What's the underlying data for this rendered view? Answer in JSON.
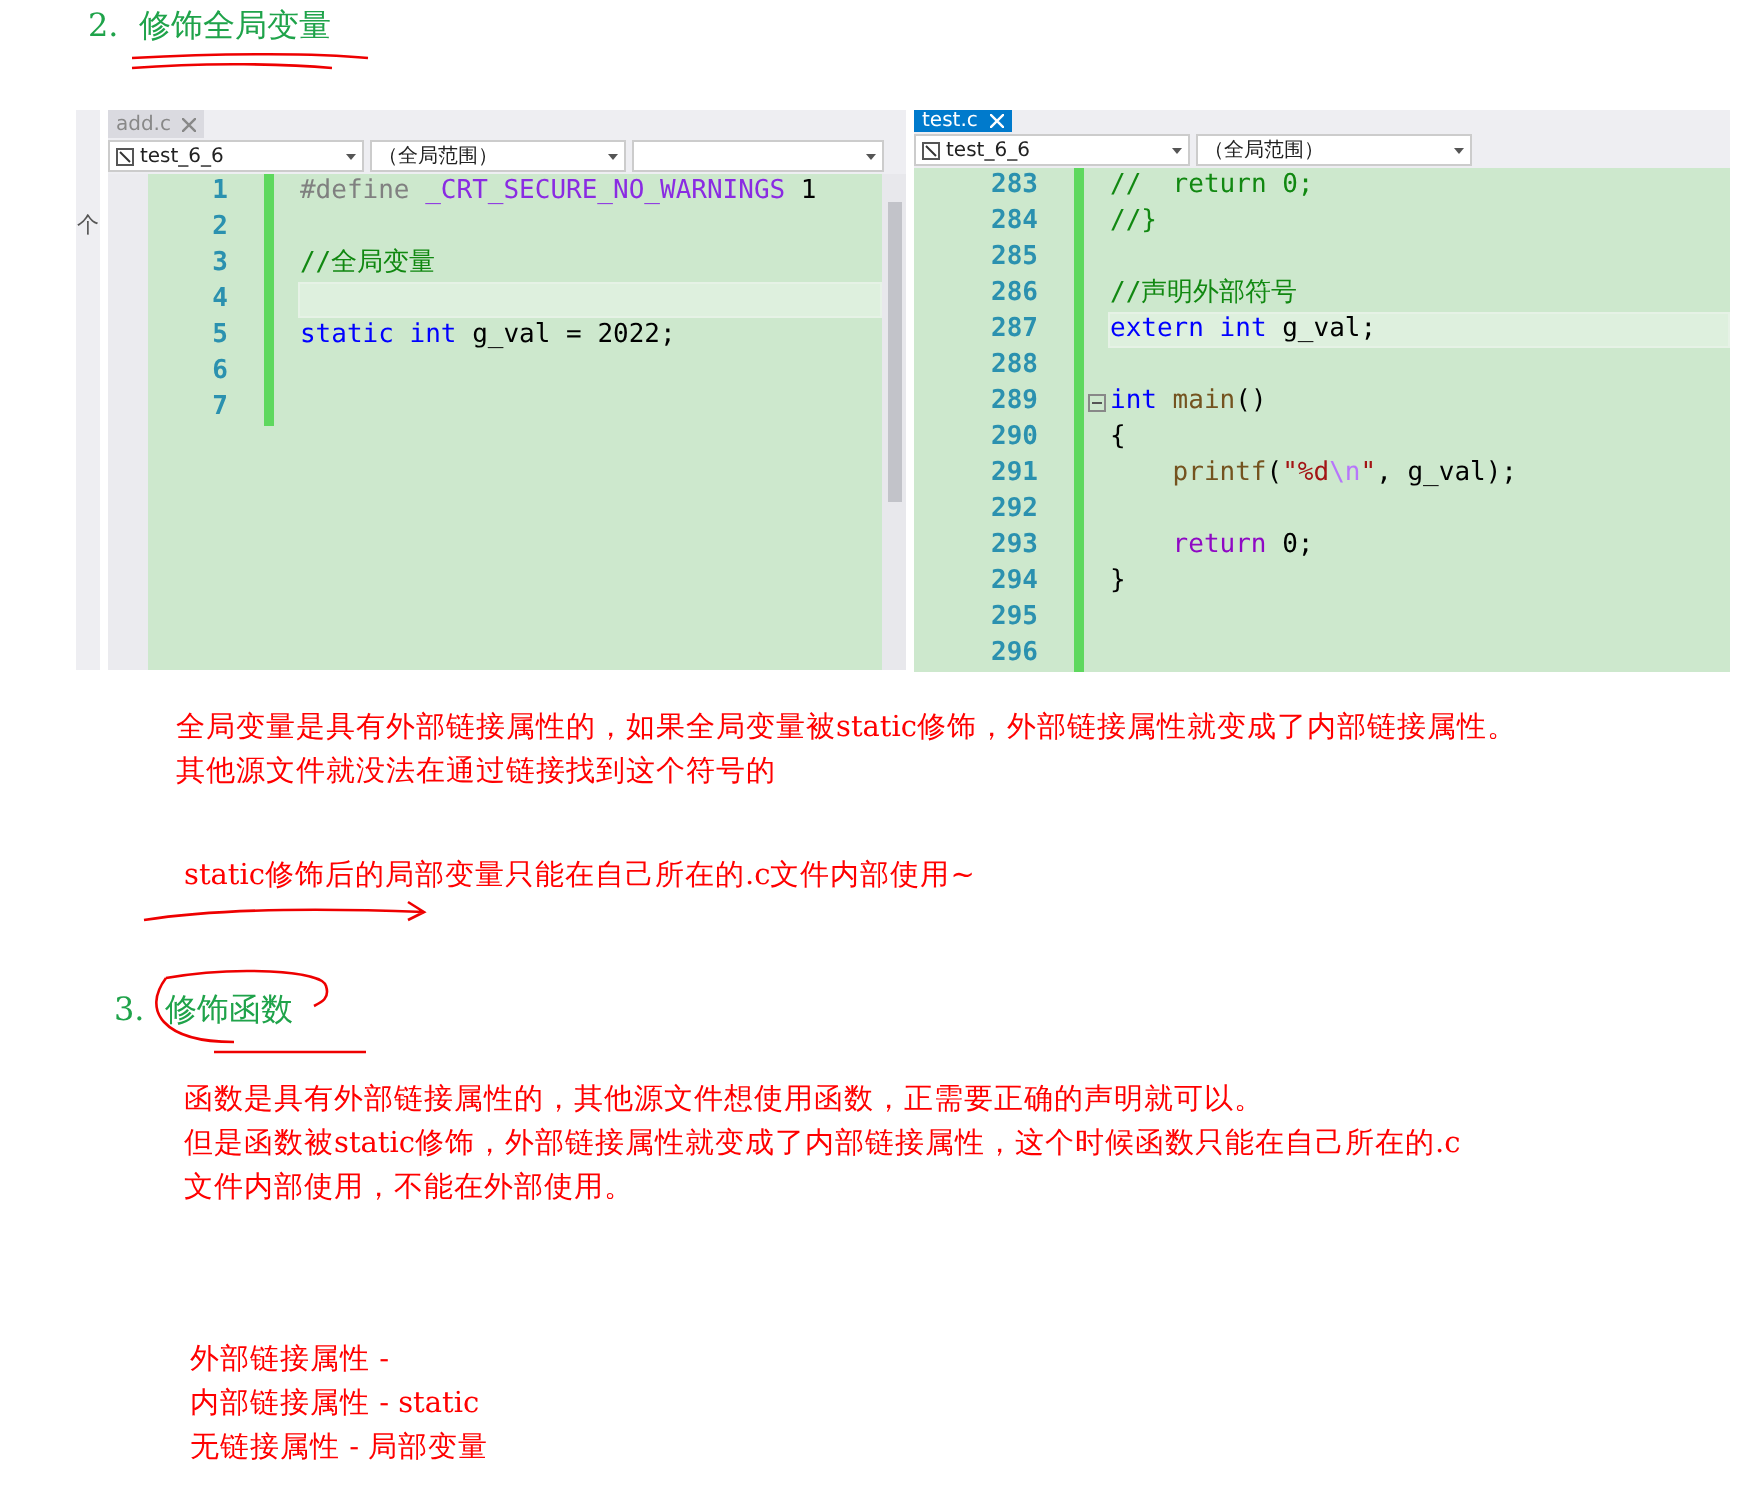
{
  "heading_1": {
    "number": "2.",
    "title": "修饰全局变量"
  },
  "side_strip": {
    "text": "个"
  },
  "editor": {
    "panes": [
      {
        "tab": {
          "label": "add.c",
          "selected": false
        },
        "dropdowns": [
          "test_6_6",
          "（全局范围）"
        ],
        "lines": [
          {
            "num": "1",
            "tokens": [
              {
                "kind": "preproc",
                "text": "#define"
              },
              {
                "kind": "macro",
                "text": " _CRT_SECURE_NO_WARNINGS"
              },
              {
                "kind": "plain",
                "text": " 1"
              }
            ]
          },
          {
            "num": "2"
          },
          {
            "num": "3",
            "tokens": [
              {
                "kind": "comment",
                "text": "//全局变量"
              }
            ]
          },
          {
            "num": "4",
            "current": true
          },
          {
            "num": "5",
            "tokens": [
              {
                "kind": "keyword",
                "text": "static"
              },
              {
                "kind": "keyword",
                "text": " int"
              },
              {
                "kind": "plain",
                "text": " g_val = 2022;"
              }
            ]
          },
          {
            "num": "6"
          },
          {
            "num": "7"
          }
        ]
      },
      {
        "tab": {
          "label": "test.c",
          "selected": true
        },
        "dropdowns": [
          "test_6_6",
          "（全局范围）"
        ],
        "lines": [
          {
            "num": "283",
            "tokens": [
              {
                "kind": "comment",
                "text": "//  return 0;"
              }
            ]
          },
          {
            "num": "284",
            "tokens": [
              {
                "kind": "comment",
                "text": "//}"
              }
            ]
          },
          {
            "num": "285"
          },
          {
            "num": "286",
            "tokens": [
              {
                "kind": "comment",
                "text": "//声明外部符号"
              }
            ]
          },
          {
            "num": "287",
            "current": true,
            "tokens": [
              {
                "kind": "keyword",
                "text": "extern"
              },
              {
                "kind": "keyword",
                "text": " int"
              },
              {
                "kind": "plain",
                "text": " g_val;"
              }
            ]
          },
          {
            "num": "288"
          },
          {
            "num": "289",
            "fold": true,
            "tokens": [
              {
                "kind": "keyword",
                "text": "int"
              },
              {
                "kind": "function",
                "text": " main"
              },
              {
                "kind": "plain",
                "text": "()"
              }
            ]
          },
          {
            "num": "290",
            "tokens": [
              {
                "kind": "plain",
                "text": "{"
              }
            ]
          },
          {
            "num": "291",
            "indent": true,
            "tokens": [
              {
                "kind": "function",
                "text": "printf"
              },
              {
                "kind": "plain",
                "text": "("
              },
              {
                "kind": "string",
                "text": "\"%d"
              },
              {
                "kind": "escape",
                "text": "\\n"
              },
              {
                "kind": "string",
                "text": "\""
              },
              {
                "kind": "plain",
                "text": ", g_val);"
              }
            ]
          },
          {
            "num": "292"
          },
          {
            "num": "293",
            "indent": true,
            "tokens": [
              {
                "kind": "control",
                "text": "return"
              },
              {
                "kind": "plain",
                "text": " 0;"
              }
            ]
          },
          {
            "num": "294",
            "tokens": [
              {
                "kind": "plain",
                "text": "}"
              }
            ]
          },
          {
            "num": "295"
          },
          {
            "num": "296"
          }
        ]
      }
    ]
  },
  "note_1": [
    "全局变量是具有外部链接属性的，如果全局变量被static修饰，外部链接属性就变成了内部链接属性。",
    "其他源文件就没法在通过链接找到这个符号的"
  ],
  "note_2": "static修饰后的局部变量只能在自己所在的.c文件内部使用~",
  "heading_2": {
    "number": "3.",
    "title": "修饰函数"
  },
  "note_3": [
    "函数是具有外部链接属性的，其他源文件想使用函数，正需要正确的声明就可以。",
    "但是函数被static修饰，外部链接属性就变成了内部链接属性，这个时候函数只能在自己所在的.c",
    "文件内部使用，不能在外部使用。"
  ],
  "summary": [
    "外部链接属性 -",
    "内部链接属性 - static",
    "无链接属性 - 局部变量"
  ]
}
